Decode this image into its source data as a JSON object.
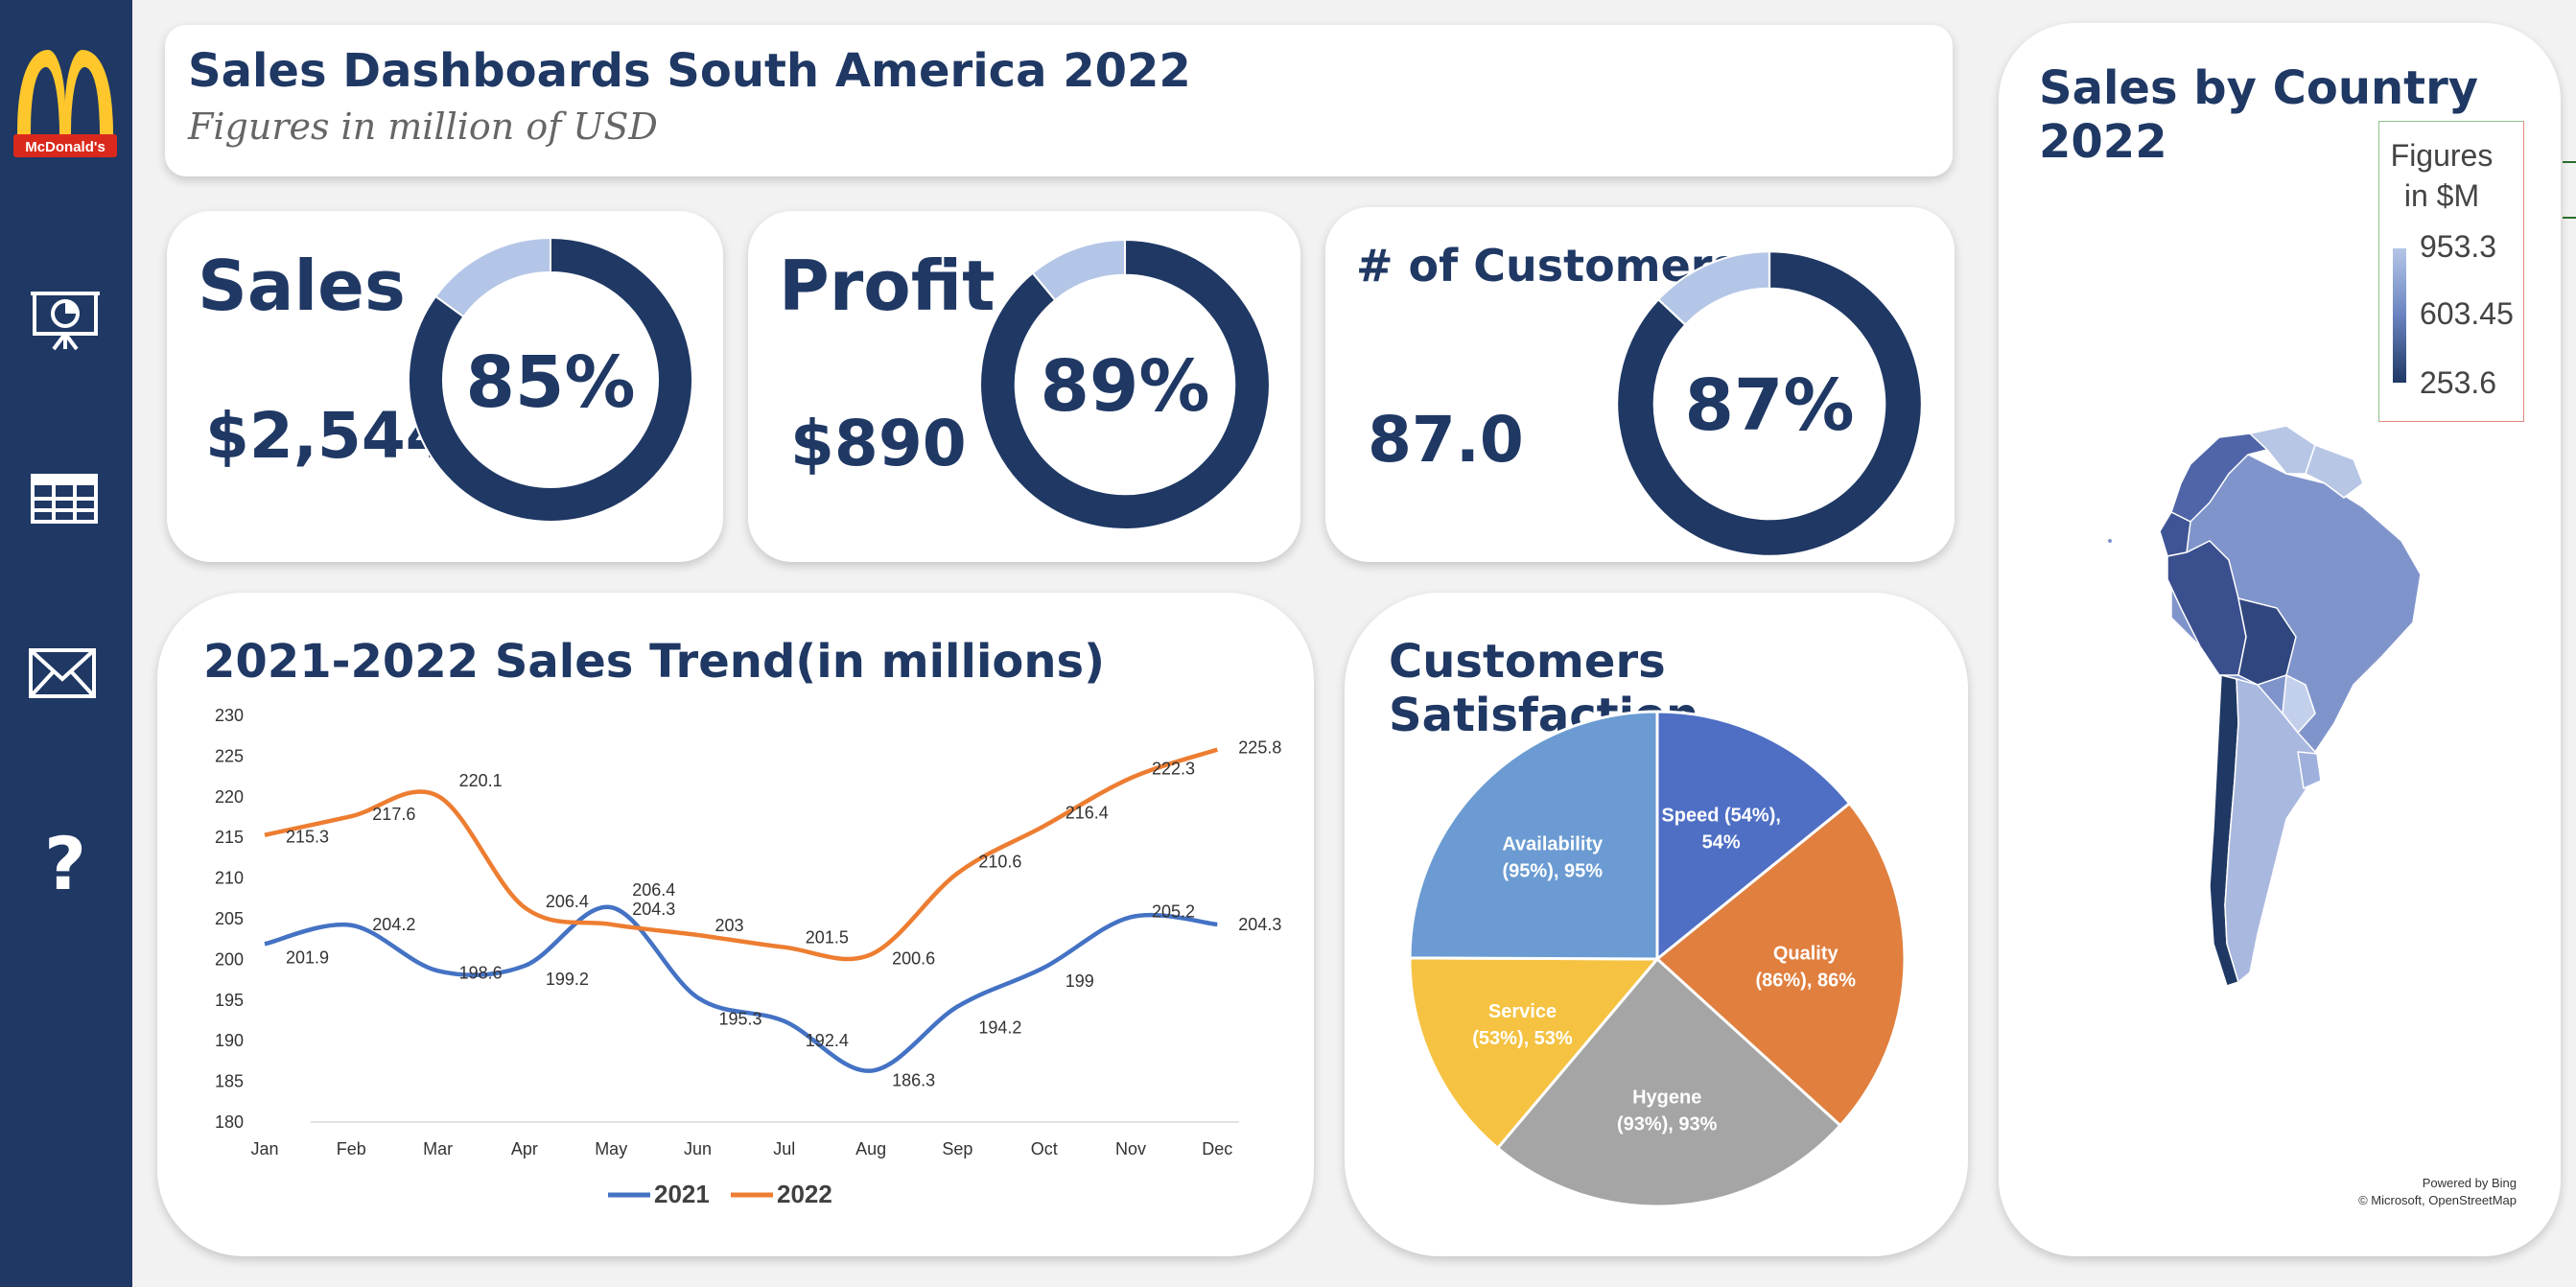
{
  "brand": {
    "name": "McDonald's"
  },
  "sidebar": {
    "items": [
      {
        "icon": "presentation-chart-icon"
      },
      {
        "icon": "table-grid-icon"
      },
      {
        "icon": "mail-icon"
      },
      {
        "icon": "help-icon",
        "glyph": "?"
      }
    ]
  },
  "header": {
    "title": "Sales Dashboards South America 2022",
    "subtitle": "Figures in million of USD"
  },
  "kpis": [
    {
      "label": "Sales",
      "value": "$2,544",
      "percent_label": "85%",
      "percent": 0.85
    },
    {
      "label": "Profit",
      "value": "$890",
      "percent_label": "89%",
      "percent": 0.89
    },
    {
      "label": "# of Customers",
      "value": "87.0",
      "percent_label": "87%",
      "percent": 0.87
    }
  ],
  "colors": {
    "navy": "#1f3864",
    "donut_rest": "#b4c6e7",
    "series_2021": "#4472c4",
    "series_2022": "#ed7d31"
  },
  "trend": {
    "title": "2021-2022 Sales Trend(in millions)"
  },
  "satisfaction": {
    "title": "Customers Satisfaction"
  },
  "map": {
    "title": "Sales by Country 2022",
    "legend_title_line1": "Figures",
    "legend_title_line2": "in $M",
    "legend_max": "953.3",
    "legend_mid": "603.45",
    "legend_min": "253.6",
    "credit_line1": "Powered by Bing",
    "credit_line2": "© Microsoft, OpenStreetMap"
  },
  "chart_data": [
    {
      "type": "line",
      "title": "2021-2022 Sales Trend(in millions)",
      "categories": [
        "Jan",
        "Feb",
        "Mar",
        "Apr",
        "May",
        "Jun",
        "Jul",
        "Aug",
        "Sep",
        "Oct",
        "Nov",
        "Dec"
      ],
      "ylim": [
        180,
        230
      ],
      "yticks": [
        "180",
        "185",
        "190",
        "195",
        "200",
        "205",
        "210",
        "215",
        "220",
        "225",
        "230"
      ],
      "series": [
        {
          "name": "2021",
          "color": "#4472c4",
          "values": [
            201.9,
            204.2,
            198.6,
            199.2,
            206.4,
            195.3,
            192.4,
            186.3,
            194.2,
            199,
            205.2,
            204.3
          ],
          "labels": [
            "201.9",
            "204.2",
            "198.6",
            "199.2",
            "206.4",
            "195.3",
            "192.4",
            "186.3",
            "194.2",
            "199",
            "205.2",
            "204.3"
          ]
        },
        {
          "name": "2022",
          "color": "#ed7d31",
          "values": [
            215.3,
            217.6,
            220.1,
            206.4,
            204.3,
            203,
            201.5,
            200.6,
            210.6,
            216.4,
            222.3,
            225.8
          ],
          "labels": [
            "215.3",
            "217.6",
            "220.1",
            "206.4",
            "204.3",
            "203",
            "201.5",
            "200.6",
            "210.6",
            "216.4",
            "222.3",
            "225.8"
          ]
        }
      ],
      "legend": "bottom"
    },
    {
      "type": "pie",
      "title": "Customers Satisfaction",
      "slices": [
        {
          "label_line1": "Speed (54%),",
          "label_line2": "54%",
          "value": 54,
          "color": "#4f6fc5"
        },
        {
          "label_line1": "Quality",
          "label_line2": "(86%), 86%",
          "value": 86,
          "color": "#e07f3e"
        },
        {
          "label_line1": "Hygene",
          "label_line2": "(93%), 93%",
          "value": 93,
          "color": "#a5a5a5"
        },
        {
          "label_line1": "Service",
          "label_line2": "(53%), 53%",
          "value": 53,
          "color": "#f5c242"
        },
        {
          "label_line1": "Availability",
          "label_line2": "(95%), 95%",
          "value": 95,
          "color": "#6b9bd2"
        }
      ]
    }
  ]
}
